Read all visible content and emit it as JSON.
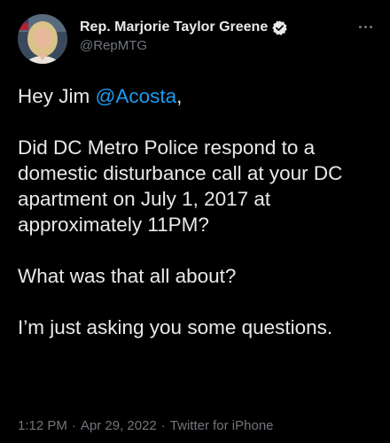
{
  "author": {
    "display_name": "Rep. Marjorie Taylor Greene",
    "handle": "@RepMTG",
    "verified": true,
    "avatar_icon": "profile-photo",
    "verified_icon": "verified-badge-icon"
  },
  "more_icon": "more-options-icon",
  "tweet": {
    "greeting_prefix": "Hey Jim ",
    "mention": "@Acosta",
    "greeting_suffix": ",",
    "paragraph_2": "Did DC Metro Police respond to a domestic disturbance call at your DC apartment on July 1, 2017 at approximately 11PM?",
    "paragraph_3": "What was that all about?",
    "paragraph_4": "I’m just asking you some questions."
  },
  "meta": {
    "time": "1:12 PM",
    "separator": "·",
    "date": "Apr 29, 2022",
    "source": "Twitter for iPhone"
  },
  "colors": {
    "background": "#000000",
    "text": "#e7e9ea",
    "secondary": "#71767b",
    "link": "#1d9bf0"
  }
}
